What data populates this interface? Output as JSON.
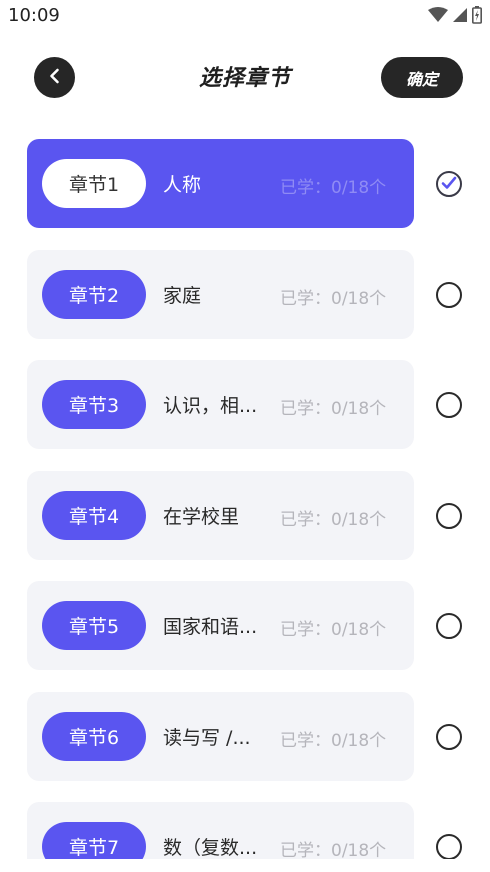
{
  "status_bar": {
    "time": "10:09",
    "icons": [
      "wifi-icon",
      "signal-icon",
      "battery-icon"
    ]
  },
  "header": {
    "back_icon": "chevron-left-icon",
    "title": "选择章节",
    "confirm_label": "确定"
  },
  "colors": {
    "accent": "#5a55f0",
    "card_bg": "#f3f4f8",
    "dark_button": "#262626"
  },
  "chapters": [
    {
      "label": "章节1",
      "name": "人称",
      "progress": "已学：0/18个",
      "selected": true
    },
    {
      "label": "章节2",
      "name": "家庭",
      "progress": "已学：0/18个",
      "selected": false
    },
    {
      "label": "章节3",
      "name": "认识，相...",
      "progress": "已学：0/18个",
      "selected": false
    },
    {
      "label": "章节4",
      "name": "在学校里",
      "progress": "已学：0/18个",
      "selected": false
    },
    {
      "label": "章节5",
      "name": "国家和语...",
      "progress": "已学：0/18个",
      "selected": false
    },
    {
      "label": "章节6",
      "name": "读与写 /...",
      "progress": "已学：0/18个",
      "selected": false
    },
    {
      "label": "章节7",
      "name": "数（复数...",
      "progress": "已学：0/18个",
      "selected": false
    }
  ]
}
